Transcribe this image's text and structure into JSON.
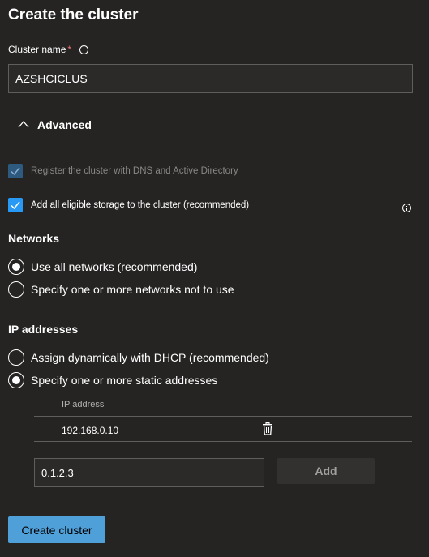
{
  "page": {
    "title": "Create the cluster"
  },
  "cluster_name": {
    "label": "Cluster name",
    "required_marker": "*",
    "value": "AZSHCICLUS"
  },
  "advanced": {
    "label": "Advanced",
    "expanded": true
  },
  "checkboxes": {
    "register_dns": {
      "label": "Register the cluster with DNS and Active Directory",
      "checked": true,
      "disabled": true
    },
    "add_storage": {
      "label": "Add all eligible storage to the cluster (recommended)",
      "checked": true,
      "disabled": false
    }
  },
  "networks": {
    "heading": "Networks",
    "options": [
      {
        "label": "Use all networks (recommended)",
        "selected": true
      },
      {
        "label": "Specify one or more networks not to use",
        "selected": false
      }
    ]
  },
  "ip_addresses": {
    "heading": "IP addresses",
    "options": [
      {
        "label": "Assign dynamically with DHCP (recommended)",
        "selected": false
      },
      {
        "label": "Specify one or more static addresses",
        "selected": true
      }
    ],
    "table": {
      "column_header": "IP address",
      "rows": [
        {
          "ip": "192.168.0.10"
        }
      ]
    },
    "new_address_value": "0.1.2.3",
    "add_label": "Add"
  },
  "create_button": {
    "label": "Create cluster"
  },
  "colors": {
    "background": "#252423",
    "accent": "#2899f5",
    "primary_button": "#4f9fd9",
    "required": "#f1707b"
  },
  "icons": {
    "info": "info-icon",
    "chevron": "chevron-up-icon",
    "check": "checkmark-icon",
    "delete": "trash-icon"
  }
}
